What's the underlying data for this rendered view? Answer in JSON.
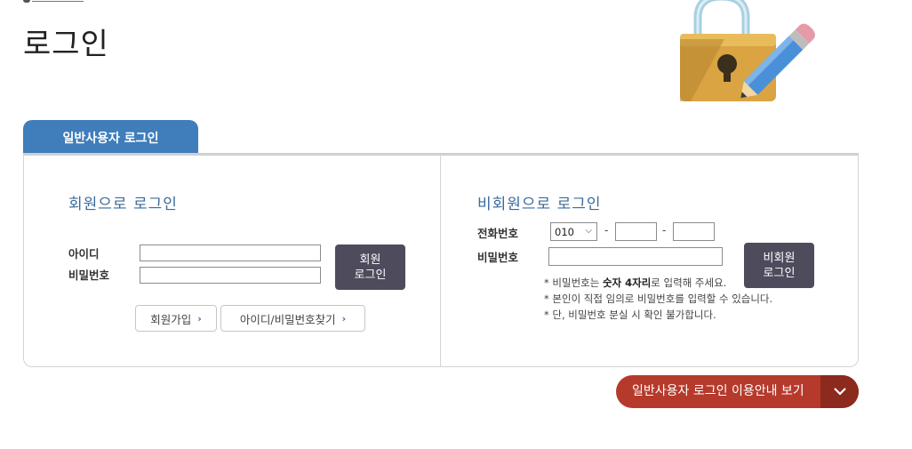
{
  "page": {
    "title": "로그인"
  },
  "tabs": [
    {
      "label": "일반사용자 로그인"
    }
  ],
  "member": {
    "heading": "회원으로 로그인",
    "id_label": "아이디",
    "id_value": "",
    "password_label": "비밀번호",
    "password_value": "",
    "login_button_line1": "회원",
    "login_button_line2": "로그인",
    "signup_label": "회원가입",
    "find_label": "아이디/비밀번호찾기"
  },
  "guest": {
    "heading": "비회원으로 로그인",
    "phone_label": "전화번호",
    "phone_prefix": "010",
    "phone_dash": "-",
    "phone_mid": "",
    "phone_last": "",
    "password_label": "비밀번호",
    "password_value": "",
    "login_button_line1": "비회원",
    "login_button_line2": "로그인",
    "notes": [
      {
        "prefix": "* 비밀번호는 ",
        "bold": "숫자 4자리",
        "suffix": "로 입력해 주세요."
      },
      {
        "text": "* 본인이 직접 임의로 비밀번호를 입력할 수 있습니다."
      },
      {
        "text": "* 단, 비밀번호 분실 시 확인 불가합니다."
      }
    ]
  },
  "guide": {
    "label": "일반사용자 로그인 이용안내 보기"
  },
  "icons": {
    "lock": "lock-icon",
    "pencil": "pencil-icon",
    "chevron": "chevron-right-icon",
    "expand": "chevron-down-icon"
  },
  "colors": {
    "tab": "#3f7dbb",
    "section_heading": "#3a6b9c",
    "login_button": "#4d4b5c",
    "guide_button": "#b63a2c",
    "guide_toggle": "#8c2a1e",
    "lock_gold": "#d9a441",
    "pencil_blue": "#4a90d9"
  }
}
